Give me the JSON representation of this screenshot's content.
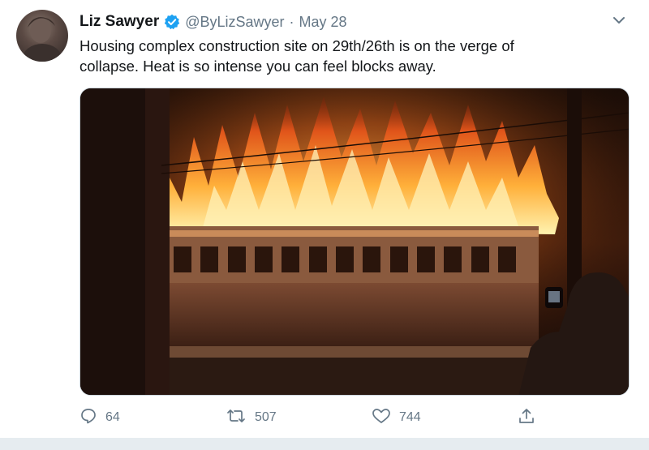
{
  "tweet": {
    "author_name": "Liz Sawyer",
    "handle": "@ByLizSawyer",
    "separator": "·",
    "date": "May 28",
    "text_lines": [
      "Housing complex construction site on 29th/26th is on the verge of",
      "collapse. Heat is so intense you can feel blocks away."
    ]
  },
  "actions": {
    "replies": "64",
    "retweets": "507",
    "likes": "744"
  },
  "icons": {
    "verified": "verified-badge-icon",
    "caret": "chevron-down-icon",
    "reply": "reply-icon",
    "retweet": "retweet-icon",
    "like": "heart-icon",
    "share": "share-icon"
  },
  "colors": {
    "verified_blue": "#1da1f2",
    "secondary_text": "#657786",
    "primary_text": "#14171a"
  }
}
